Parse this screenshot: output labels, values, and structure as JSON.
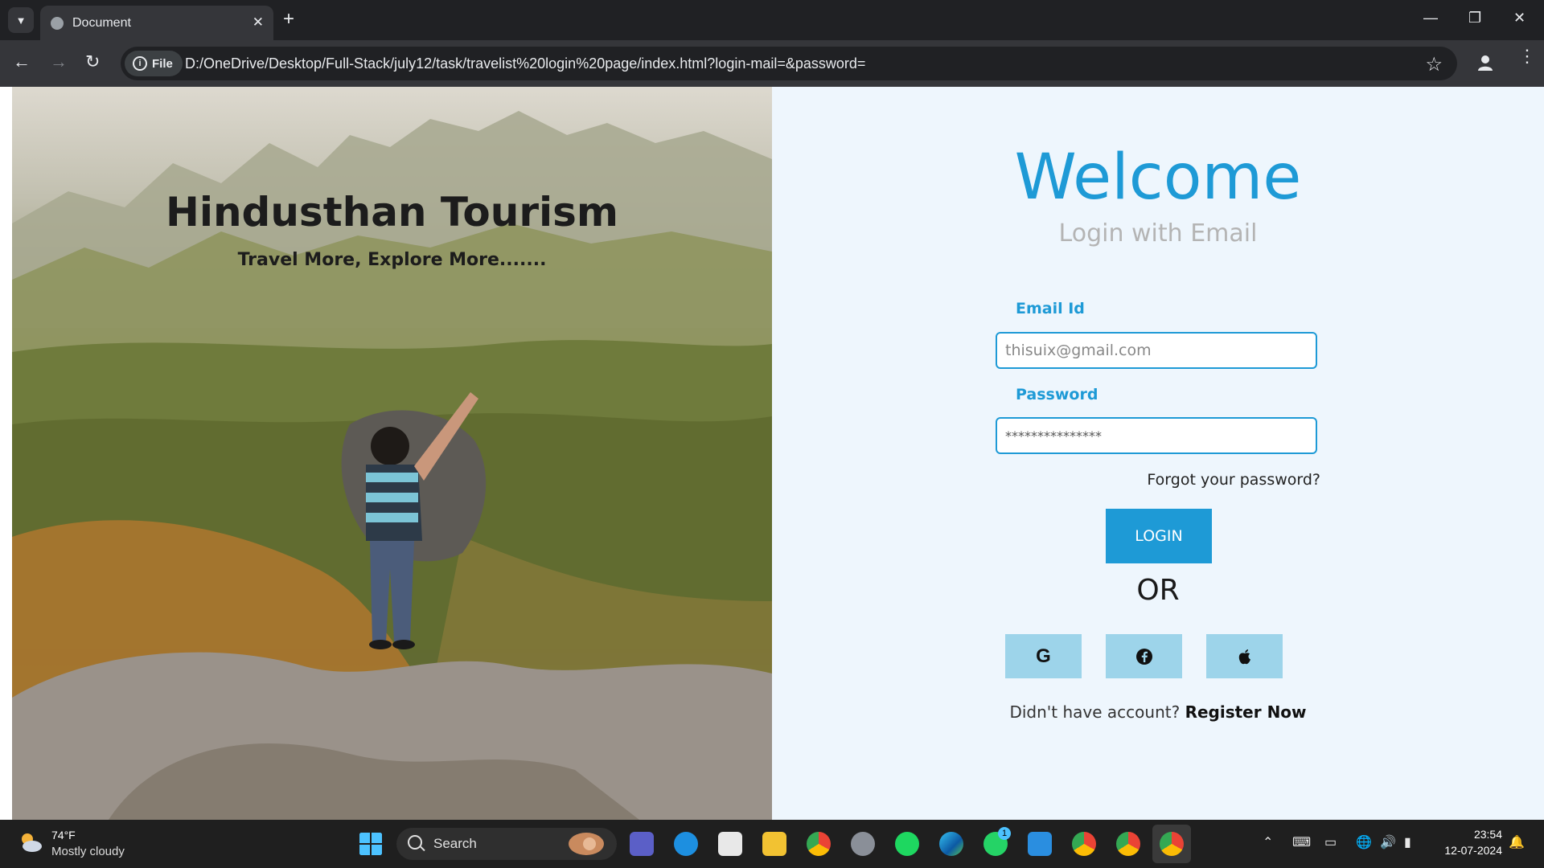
{
  "browser": {
    "tab_title": "Document",
    "url_chip": "File",
    "url": "D:/OneDrive/Desktop/Full-Stack/july12/task/travelist%20login%20page/index.html?login-mail=&password="
  },
  "hero": {
    "title": "Hindusthan Tourism",
    "subtitle": "Travel More, Explore More......."
  },
  "login": {
    "welcome": "Welcome",
    "subtitle": "Login with Email",
    "email_label": "Email Id",
    "email_placeholder": "thisuix@gmail.com",
    "password_label": "Password",
    "password_placeholder": "***************",
    "forgot": "Forgot your password?",
    "login_button": "LOGIN",
    "or": "OR",
    "social": [
      {
        "icon": "google-icon",
        "glyph": "G"
      },
      {
        "icon": "facebook-icon",
        "glyph": "f"
      },
      {
        "icon": "apple-icon",
        "glyph": ""
      }
    ],
    "register_prompt": "Didn't have account?",
    "register_link": "Register Now"
  },
  "taskbar": {
    "weather_temp": "74°F",
    "weather_condition": "Mostly cloudy",
    "search_label": "Search",
    "clock_time": "23:54",
    "clock_date": "12-07-2024",
    "whatsapp_badge": "1"
  },
  "colors": {
    "accent": "#1e9ad6",
    "social_button": "#9dd4ea",
    "panel_bg": "#eef6fd"
  }
}
